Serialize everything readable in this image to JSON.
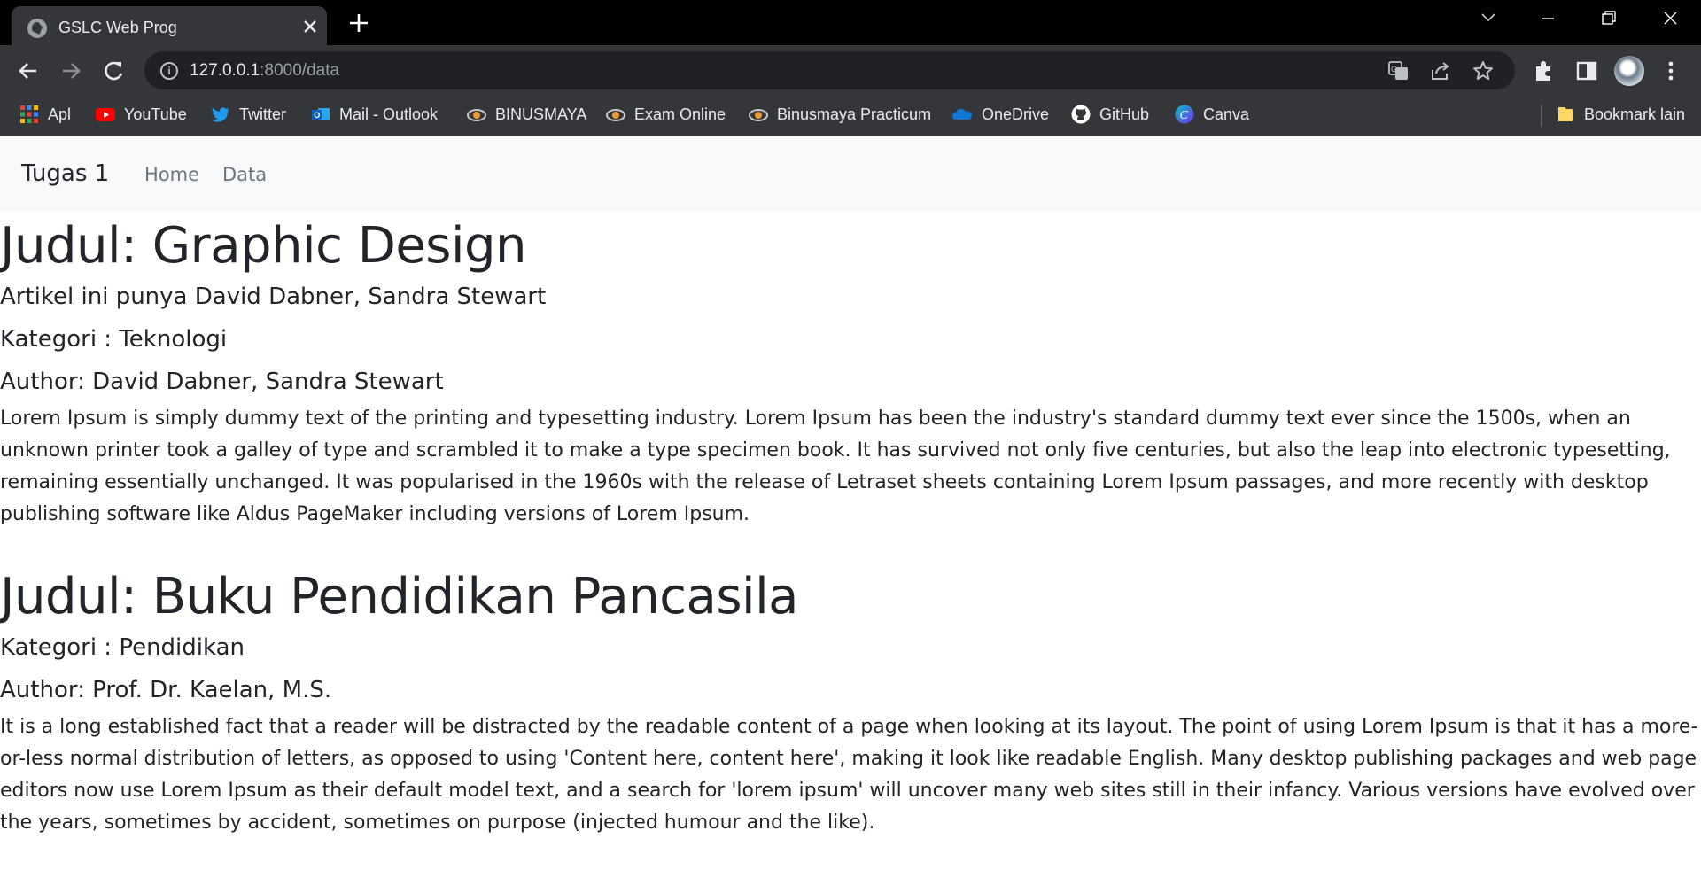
{
  "browser": {
    "tab_title": "GSLC Web Prog",
    "url_host": "127.0.0.1",
    "url_path": ":8000/data",
    "bookmarks": [
      {
        "label": "Apl",
        "icon": "apps-grid-icon"
      },
      {
        "label": "YouTube",
        "icon": "youtube-icon"
      },
      {
        "label": "Twitter",
        "icon": "twitter-icon"
      },
      {
        "label": "Mail - Outlook",
        "icon": "outlook-icon"
      },
      {
        "label": "BINUSMAYA",
        "icon": "binusmaya-icon"
      },
      {
        "label": "Exam Online",
        "icon": "exam-online-icon"
      },
      {
        "label": "Binusmaya Practicum",
        "icon": "binusmaya-practicum-icon"
      },
      {
        "label": "OneDrive",
        "icon": "onedrive-icon"
      },
      {
        "label": "GitHub",
        "icon": "github-icon"
      },
      {
        "label": "Canva",
        "icon": "canva-icon"
      }
    ],
    "other_bookmarks": "Bookmark lain"
  },
  "site": {
    "brand": "Tugas 1",
    "nav": [
      "Home",
      "Data"
    ]
  },
  "articles": [
    {
      "judul": "Judul: Graphic Design",
      "owner_line": "Artikel ini punya David Dabner, Sandra Stewart",
      "kategori": "Kategori : Teknologi",
      "author": "Author: David Dabner, Sandra Stewart",
      "body": "Lorem Ipsum is simply dummy text of the printing and typesetting industry. Lorem Ipsum has been the industry's standard dummy text ever since the 1500s, when an unknown printer took a galley of type and scrambled it to make a type specimen book. It has survived not only five centuries, but also the leap into electronic typesetting, remaining essentially unchanged. It was popularised in the 1960s with the release of Letraset sheets containing Lorem Ipsum passages, and more recently with desktop publishing software like Aldus PageMaker including versions of Lorem Ipsum."
    },
    {
      "judul": "Judul: Buku Pendidikan Pancasila",
      "kategori": "Kategori : Pendidikan",
      "author": "Author: Prof. Dr. Kaelan, M.S.",
      "body": "It is a long established fact that a reader will be distracted by the readable content of a page when looking at its layout. The point of using Lorem Ipsum is that it has a more-or-less normal distribution of letters, as opposed to using 'Content here, content here', making it look like readable English. Many desktop publishing packages and web page editors now use Lorem Ipsum as their default model text, and a search for 'lorem ipsum' will uncover many web sites still in their infancy. Various versions have evolved over the years, sometimes by accident, sometimes on purpose (injected humour and the like)."
    }
  ]
}
